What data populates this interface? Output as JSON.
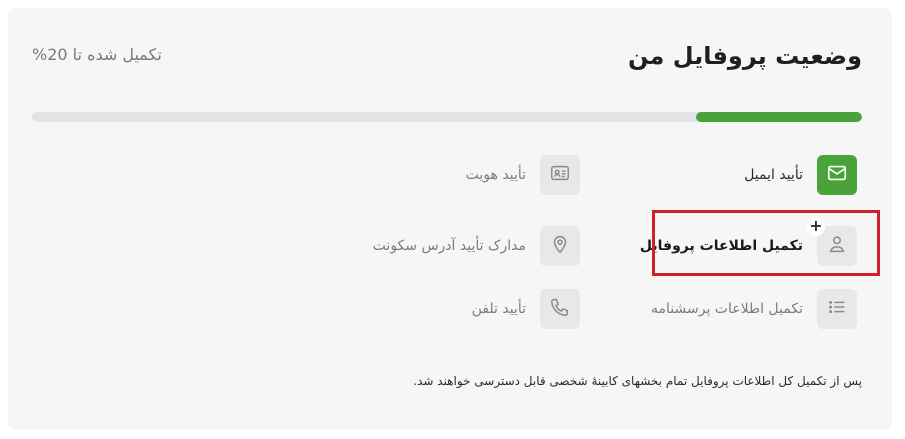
{
  "header": {
    "title": "وضعیت پروفایل من",
    "progress_text": "تکمیل شده تا 20%"
  },
  "progress": {
    "percent": 20,
    "fill_color": "#4aa33a",
    "track_color": "#e2e3e6"
  },
  "steps": [
    {
      "label": "تأیید ایمیل",
      "icon": "envelope-icon",
      "status": "done"
    },
    {
      "label": "تأیید هویت",
      "icon": "id-card-icon",
      "status": "pending"
    },
    {
      "label": "تکمیل اطلاعات پروفایل",
      "icon": "user-icon",
      "status": "active",
      "badge": "+"
    },
    {
      "label": "مدارک تأیید آدرس سکونت",
      "icon": "location-pin-icon",
      "status": "pending"
    },
    {
      "label": "تکمیل اطلاعات پرسشنامه",
      "icon": "list-icon",
      "status": "pending"
    },
    {
      "label": "تأیید تلفن",
      "icon": "phone-icon",
      "status": "pending"
    }
  ],
  "footnote": "پس از تکمیل کل اطلاعات پروفایل تمام بخشهای کابینهٔ شخصی قابل دسترسی خواهند شد."
}
